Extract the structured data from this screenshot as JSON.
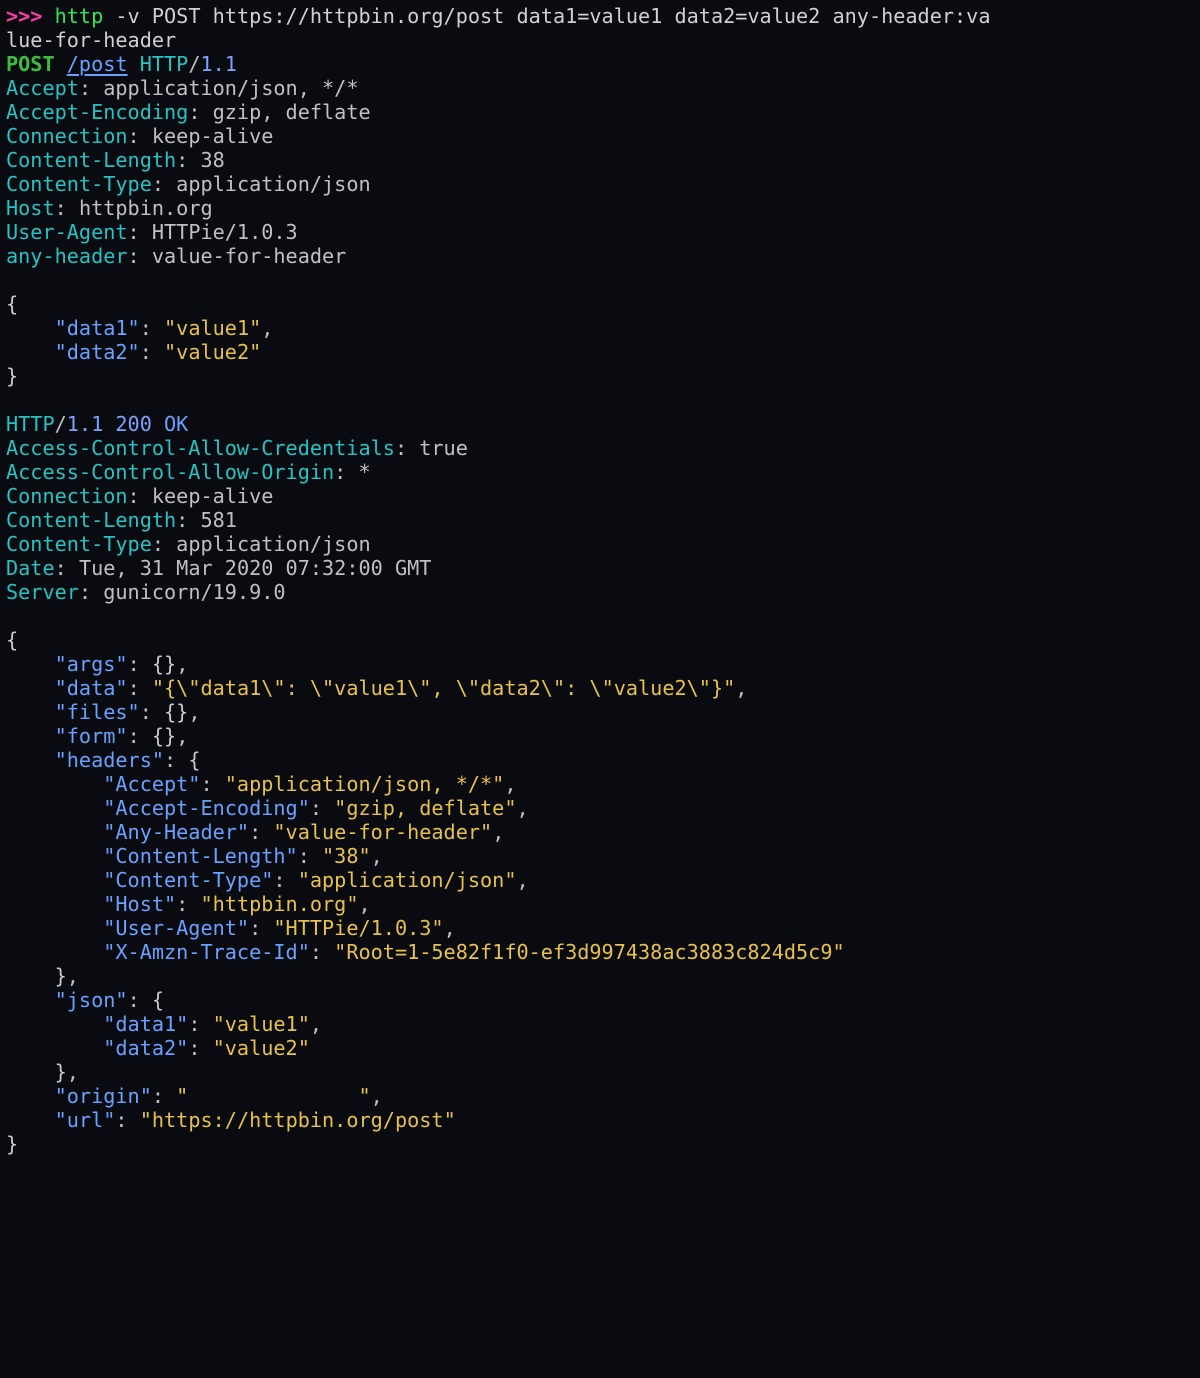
{
  "prompt": ">>>",
  "command": {
    "cmd": "http",
    "args_line1": " -v POST https://httpbin.org/post data1=value1 data2=value2 any-header:va",
    "args_line2": "lue-for-header"
  },
  "request": {
    "method": "POST",
    "path": "/post",
    "http": "HTTP",
    "version": "1.1",
    "headers": [
      {
        "name": "Accept",
        "value": "application/json, */*"
      },
      {
        "name": "Accept-Encoding",
        "value": "gzip, deflate"
      },
      {
        "name": "Connection",
        "value": "keep-alive"
      },
      {
        "name": "Content-Length",
        "value": "38"
      },
      {
        "name": "Content-Type",
        "value": "application/json"
      },
      {
        "name": "Host",
        "value": "httpbin.org"
      },
      {
        "name": "User-Agent",
        "value": "HTTPie/1.0.3"
      },
      {
        "name": "any-header",
        "value": "value-for-header"
      }
    ],
    "body": [
      {
        "key": "\"data1\"",
        "value": "\"value1\"",
        "trail": ","
      },
      {
        "key": "\"data2\"",
        "value": "\"value2\"",
        "trail": ""
      }
    ]
  },
  "response": {
    "http": "HTTP",
    "version": "1.1",
    "status_code": "200",
    "status_text": "OK",
    "headers": [
      {
        "name": "Access-Control-Allow-Credentials",
        "value": "true"
      },
      {
        "name": "Access-Control-Allow-Origin",
        "value": "*"
      },
      {
        "name": "Connection",
        "value": "keep-alive"
      },
      {
        "name": "Content-Length",
        "value": "581"
      },
      {
        "name": "Content-Type",
        "value": "application/json"
      },
      {
        "name": "Date",
        "value": "Tue, 31 Mar 2020 07:32:00 GMT"
      },
      {
        "name": "Server",
        "value": "gunicorn/19.9.0"
      }
    ],
    "body": {
      "top": [
        {
          "key": "\"args\"",
          "raw": "{}",
          "trail": ","
        },
        {
          "key": "\"data\"",
          "value": "\"{\\\"data1\\\": \\\"value1\\\", \\\"data2\\\": \\\"value2\\\"}\"",
          "trail": ","
        },
        {
          "key": "\"files\"",
          "raw": "{}",
          "trail": ","
        },
        {
          "key": "\"form\"",
          "raw": "{}",
          "trail": ","
        }
      ],
      "headers_key": "\"headers\"",
      "headers": [
        {
          "key": "\"Accept\"",
          "value": "\"application/json, */*\"",
          "trail": ","
        },
        {
          "key": "\"Accept-Encoding\"",
          "value": "\"gzip, deflate\"",
          "trail": ","
        },
        {
          "key": "\"Any-Header\"",
          "value": "\"value-for-header\"",
          "trail": ","
        },
        {
          "key": "\"Content-Length\"",
          "value": "\"38\"",
          "trail": ","
        },
        {
          "key": "\"Content-Type\"",
          "value": "\"application/json\"",
          "trail": ","
        },
        {
          "key": "\"Host\"",
          "value": "\"httpbin.org\"",
          "trail": ","
        },
        {
          "key": "\"User-Agent\"",
          "value": "\"HTTPie/1.0.3\"",
          "trail": ","
        },
        {
          "key": "\"X-Amzn-Trace-Id\"",
          "value": "\"Root=1-5e82f1f0-ef3d997438ac3883c824d5c9\"",
          "trail": ""
        }
      ],
      "json_key": "\"json\"",
      "json": [
        {
          "key": "\"data1\"",
          "value": "\"value1\"",
          "trail": ","
        },
        {
          "key": "\"data2\"",
          "value": "\"value2\"",
          "trail": ""
        }
      ],
      "origin": {
        "key": "\"origin\"",
        "value_prefix": "\"",
        "value_redacted": "              ",
        "value_suffix": "\"",
        "trail": ","
      },
      "url": {
        "key": "\"url\"",
        "value": "\"https://httpbin.org/post\"",
        "trail": ""
      }
    }
  }
}
